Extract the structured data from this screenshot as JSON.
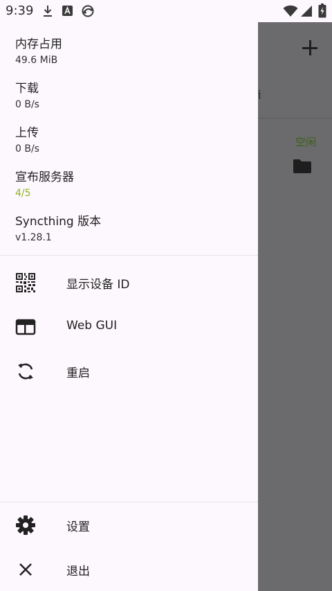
{
  "status_bar": {
    "time": "9:39",
    "icons": [
      "download-icon",
      "a-badge-icon",
      "sync-status-icon",
      "wifi-icon",
      "signal-icon",
      "battery-charging-icon"
    ]
  },
  "drawer": {
    "stats": [
      {
        "label": "内存占用",
        "value": "49.6 MiB"
      },
      {
        "label": "下载",
        "value": "0 B/s"
      },
      {
        "label": "上传",
        "value": "0 B/s"
      },
      {
        "label": "宣布服务器",
        "value": "4/5"
      },
      {
        "label": "Syncthing 版本",
        "value": "v1.28.1"
      }
    ],
    "menu": [
      {
        "label": "显示设备 ID",
        "icon": "qr-code-icon"
      },
      {
        "label": "Web GUI",
        "icon": "web-window-icon"
      },
      {
        "label": "重启",
        "icon": "restart-icon"
      }
    ],
    "bottom_menu": [
      {
        "label": "设置",
        "icon": "gear-icon"
      },
      {
        "label": "退出",
        "icon": "close-icon"
      }
    ]
  },
  "background": {
    "tab_fragment": "fi",
    "folder_status": "空闲"
  },
  "colors": {
    "drawer_bg": "#fdf8fd",
    "scrim": "#6b6a6d",
    "accent_green": "#8bb321",
    "text": "#1f1f1f"
  }
}
